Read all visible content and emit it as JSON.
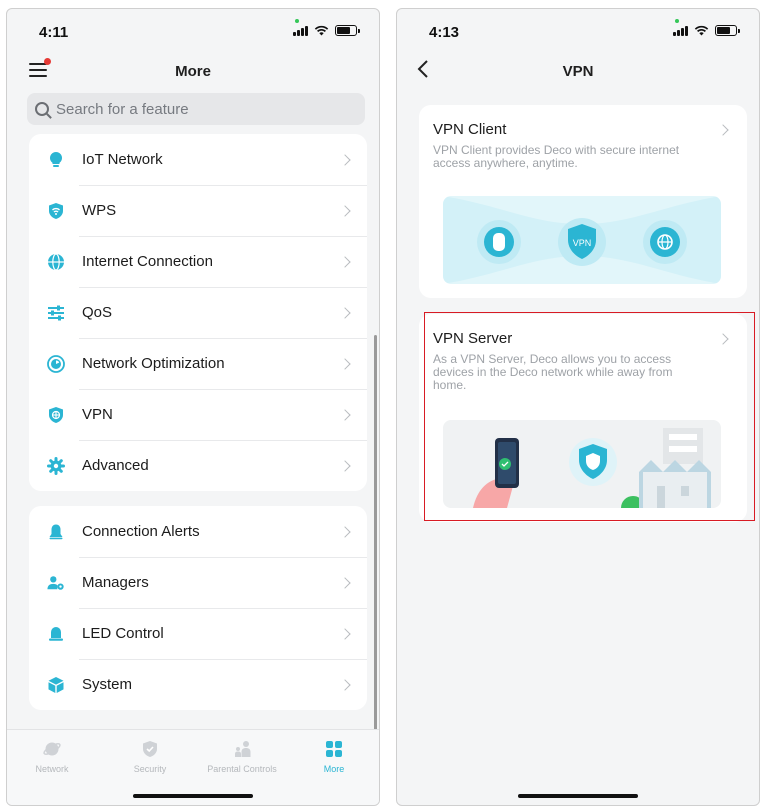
{
  "left_screen": {
    "status_time": "4:11",
    "title": "More",
    "search_placeholder": "Search for a feature",
    "group1": [
      {
        "label": "IoT Network",
        "icon": "bulb-icon"
      },
      {
        "label": "WPS",
        "icon": "wps-icon"
      },
      {
        "label": "Internet Connection",
        "icon": "globe-icon"
      },
      {
        "label": "QoS",
        "icon": "sliders-icon"
      },
      {
        "label": "Network Optimization",
        "icon": "optimization-icon"
      },
      {
        "label": "VPN",
        "icon": "vpn-shield-icon"
      },
      {
        "label": "Advanced",
        "icon": "gear-icon"
      }
    ],
    "group2": [
      {
        "label": "Connection Alerts",
        "icon": "bell-icon"
      },
      {
        "label": "Managers",
        "icon": "managers-icon"
      },
      {
        "label": "LED Control",
        "icon": "led-icon"
      },
      {
        "label": "System",
        "icon": "cube-icon"
      }
    ],
    "tabs": [
      {
        "label": "Network",
        "icon": "network-icon",
        "active": false
      },
      {
        "label": "Security",
        "icon": "security-icon",
        "active": false
      },
      {
        "label": "Parental Controls",
        "icon": "parental-icon",
        "active": false
      },
      {
        "label": "More",
        "icon": "more-grid-icon",
        "active": true
      }
    ]
  },
  "right_screen": {
    "status_time": "4:13",
    "title": "VPN",
    "client": {
      "title": "VPN Client",
      "description": "VPN Client provides Deco with secure internet access anywhere, anytime.",
      "badge": "VPN"
    },
    "server": {
      "title": "VPN Server",
      "description": "As a VPN Server, Deco allows you to access devices in the Deco network while away from home.",
      "selected": true
    }
  },
  "colors": {
    "accent": "#2bb5d3",
    "highlight_border": "#d81b24",
    "notification_dot": "#e53935"
  }
}
